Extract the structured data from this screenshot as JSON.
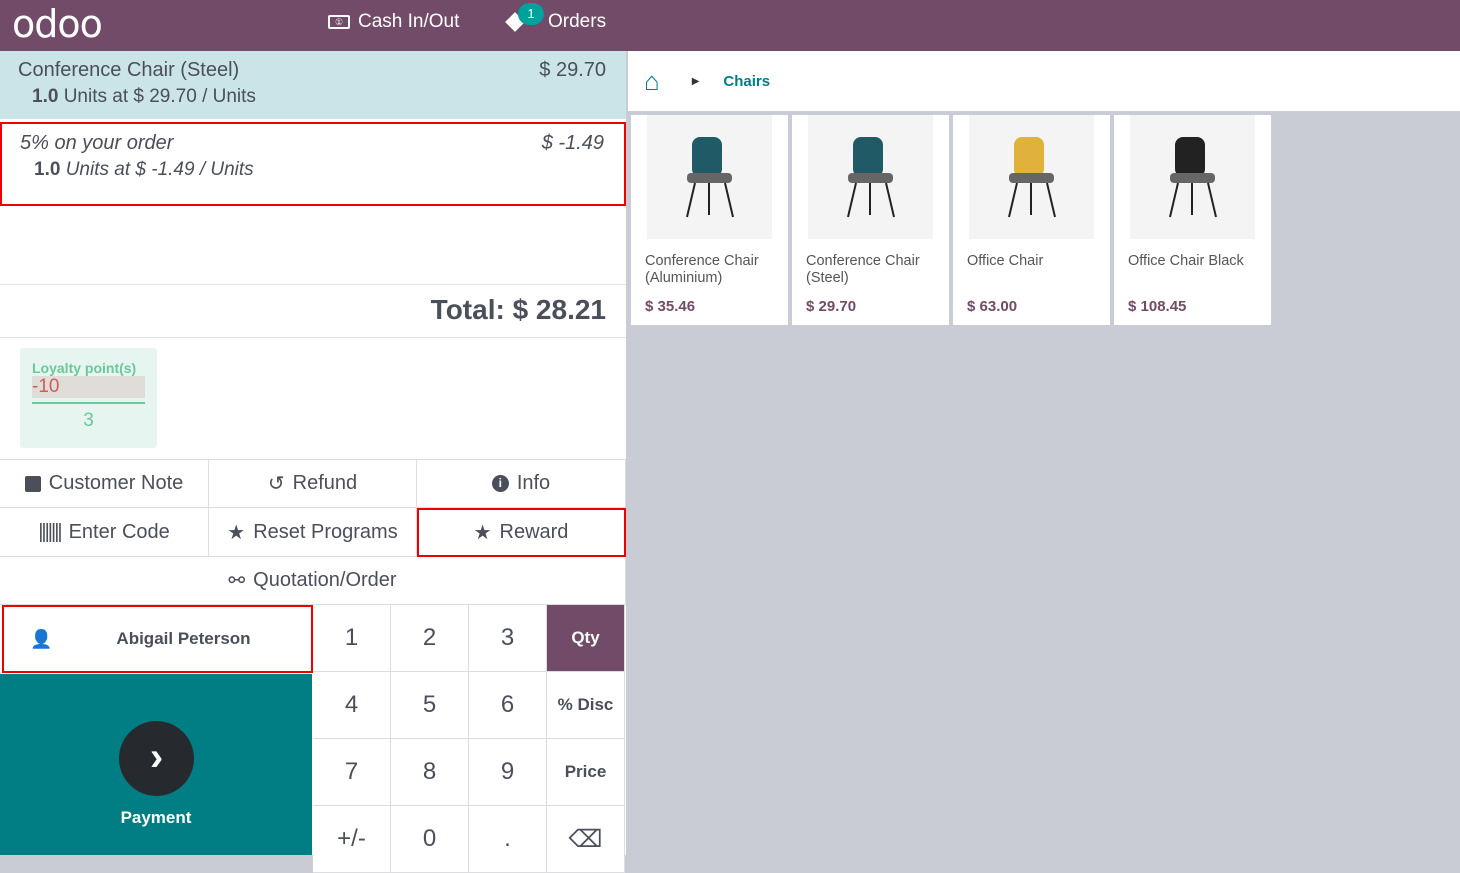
{
  "topbar": {
    "logo": "odoo",
    "cash": "Cash In/Out",
    "orders": "Orders",
    "orders_badge": "1"
  },
  "order": {
    "lines": [
      {
        "name": "Conference Chair (Steel)",
        "price": "$ 29.70",
        "qty": "1.0",
        "detail": "Units at $ 29.70 / Units"
      },
      {
        "name": "5% on your order",
        "price": "$ -1.49",
        "qty": "1.0",
        "detail": "Units at $ -1.49 / Units"
      }
    ],
    "total": "Total: $ 28.21",
    "loyalty": {
      "label": "Loyalty point(s)",
      "spent": "-10",
      "remaining": "3"
    }
  },
  "controls": {
    "customer_note": "Customer Note",
    "refund": "Refund",
    "info": "Info",
    "enter_code": "Enter Code",
    "reset_programs": "Reset Programs",
    "reward": "Reward",
    "quotation": "Quotation/Order"
  },
  "customer": "Abigail Peterson",
  "payment": "Payment",
  "numpad": {
    "k1": "1",
    "k2": "2",
    "k3": "3",
    "qty": "Qty",
    "k4": "4",
    "k5": "5",
    "k6": "6",
    "disc": "% Disc",
    "k7": "7",
    "k8": "8",
    "k9": "9",
    "price": "Price",
    "pm": "+/-",
    "k0": "0",
    "dot": ".",
    "back": "⌫"
  },
  "breadcrumb": {
    "category": "Chairs"
  },
  "products": [
    {
      "name": "Conference Chair (Aluminium)",
      "price": "$ 35.46",
      "color": "#1f5a66"
    },
    {
      "name": "Conference Chair (Steel)",
      "price": "$ 29.70",
      "color": "#1f5a66"
    },
    {
      "name": "Office Chair",
      "price": "$ 63.00",
      "color": "#e0b23b"
    },
    {
      "name": "Office Chair Black",
      "price": "$ 108.45",
      "color": "#222222"
    }
  ]
}
